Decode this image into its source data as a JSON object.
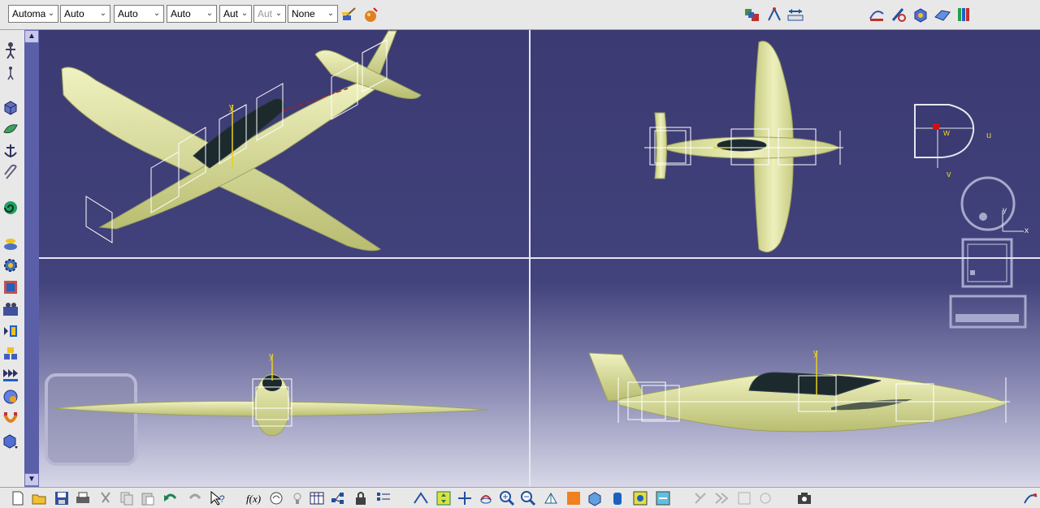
{
  "toolbar": {
    "combos": [
      {
        "value": "Automa",
        "disabled": false
      },
      {
        "value": "Auto",
        "disabled": false
      },
      {
        "value": "Auto",
        "disabled": false
      },
      {
        "value": "Auto",
        "disabled": false
      },
      {
        "value": "Aut",
        "disabled": false
      },
      {
        "value": "Aut",
        "disabled": true
      },
      {
        "value": "None",
        "disabled": false
      }
    ]
  },
  "viewport": {
    "compass": {
      "u": "u",
      "v": "v",
      "w": "w"
    },
    "axes": {
      "x": "x",
      "y": "y"
    },
    "axis_labels": {
      "top_left_y": "y",
      "bottom_left_y": "y",
      "bottom_right_y": "y"
    }
  },
  "colors": {
    "viewport_top": "#3b3a72",
    "viewport_bottom": "#d8d8e8",
    "model_fill": "#e4e6a6",
    "model_shade": "#c7cc7e",
    "bounding_box": "#ffffff",
    "axis_yellow": "#e8d020",
    "compass_fill": "#3b3a72",
    "compass_dot": "#d01010"
  }
}
